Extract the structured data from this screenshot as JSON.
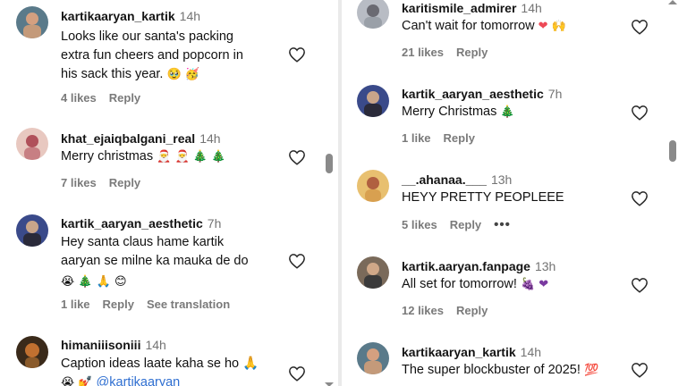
{
  "left": [
    {
      "username": "kartikaaryan_kartik",
      "time": "14h",
      "lines": [
        "Looks like our santa's packing",
        "extra fun cheers and popcorn in",
        "his sack this year."
      ],
      "emojis": "🥹 🥳",
      "likes": "4 likes",
      "reply": "Reply",
      "extra": "",
      "avatar_color": "#c49a7a"
    },
    {
      "username": "khat_ejaiqbalgani_real",
      "time": "14h",
      "lines": [
        "Merry christmas"
      ],
      "emojis": "🎅 🎅 🎄 🎄",
      "likes": "7 likes",
      "reply": "Reply",
      "extra": "",
      "avatar_color": "#c77f83"
    },
    {
      "username": "kartik_aaryan_aesthetic",
      "time": "7h",
      "lines": [
        "Hey santa claus hame kartik",
        "aaryan se milne ka mauka de do"
      ],
      "emojis": "😭 🎄 🙏 😊",
      "likes": "1 like",
      "reply": "Reply",
      "extra": "See translation",
      "avatar_color": "#5a6db0"
    },
    {
      "username": "himaniiisoniii",
      "time": "14h",
      "lines": [
        "Caption ideas laate kaha se ho 🙏"
      ],
      "emojis": "😭 💅",
      "mention": "@kartikaaryan",
      "likes": "",
      "reply": "",
      "extra": "",
      "avatar_color": "#8a5a2a"
    }
  ],
  "right": [
    {
      "username": "karitismile_admirer",
      "time": "14h",
      "lines": [
        "Can't wait for tomorrow"
      ],
      "emojis": "❤ 🙌",
      "likes": "21 likes",
      "reply": "Reply",
      "extra": "",
      "avatar_color": "#9aa0a8"
    },
    {
      "username": "kartik_aaryan_aesthetic",
      "time": "7h",
      "lines": [
        "Merry Christmas"
      ],
      "emojis": "🎄",
      "likes": "1 like",
      "reply": "Reply",
      "extra": "",
      "avatar_color": "#5a6db0"
    },
    {
      "username": "__.ahanaa.___",
      "time": "13h",
      "lines": [
        "HEYY PRETTY PEOPLEEE"
      ],
      "emojis": "",
      "likes": "5 likes",
      "reply": "Reply",
      "extra": "•••",
      "avatar_color": "#d8a050"
    },
    {
      "username": "kartik.aaryan.fanpage",
      "time": "13h",
      "lines": [
        "All set for tomorrow!"
      ],
      "emojis": "🍇 ❤",
      "likes": "12 likes",
      "reply": "Reply",
      "extra": "",
      "avatar_color": "#6b5a4a"
    },
    {
      "username": "kartikaaryan_kartik",
      "time": "14h",
      "lines": [
        "The super blockbuster of 2025!"
      ],
      "emojis": "💯",
      "likes": "",
      "reply": "",
      "extra": "",
      "avatar_color": "#c49a7a"
    }
  ],
  "colors": {
    "heart_outline": "#262626",
    "red_heart": "#ed4956",
    "mention": "#2f6fd1",
    "scroll_thumb": "#8a8a8a"
  }
}
